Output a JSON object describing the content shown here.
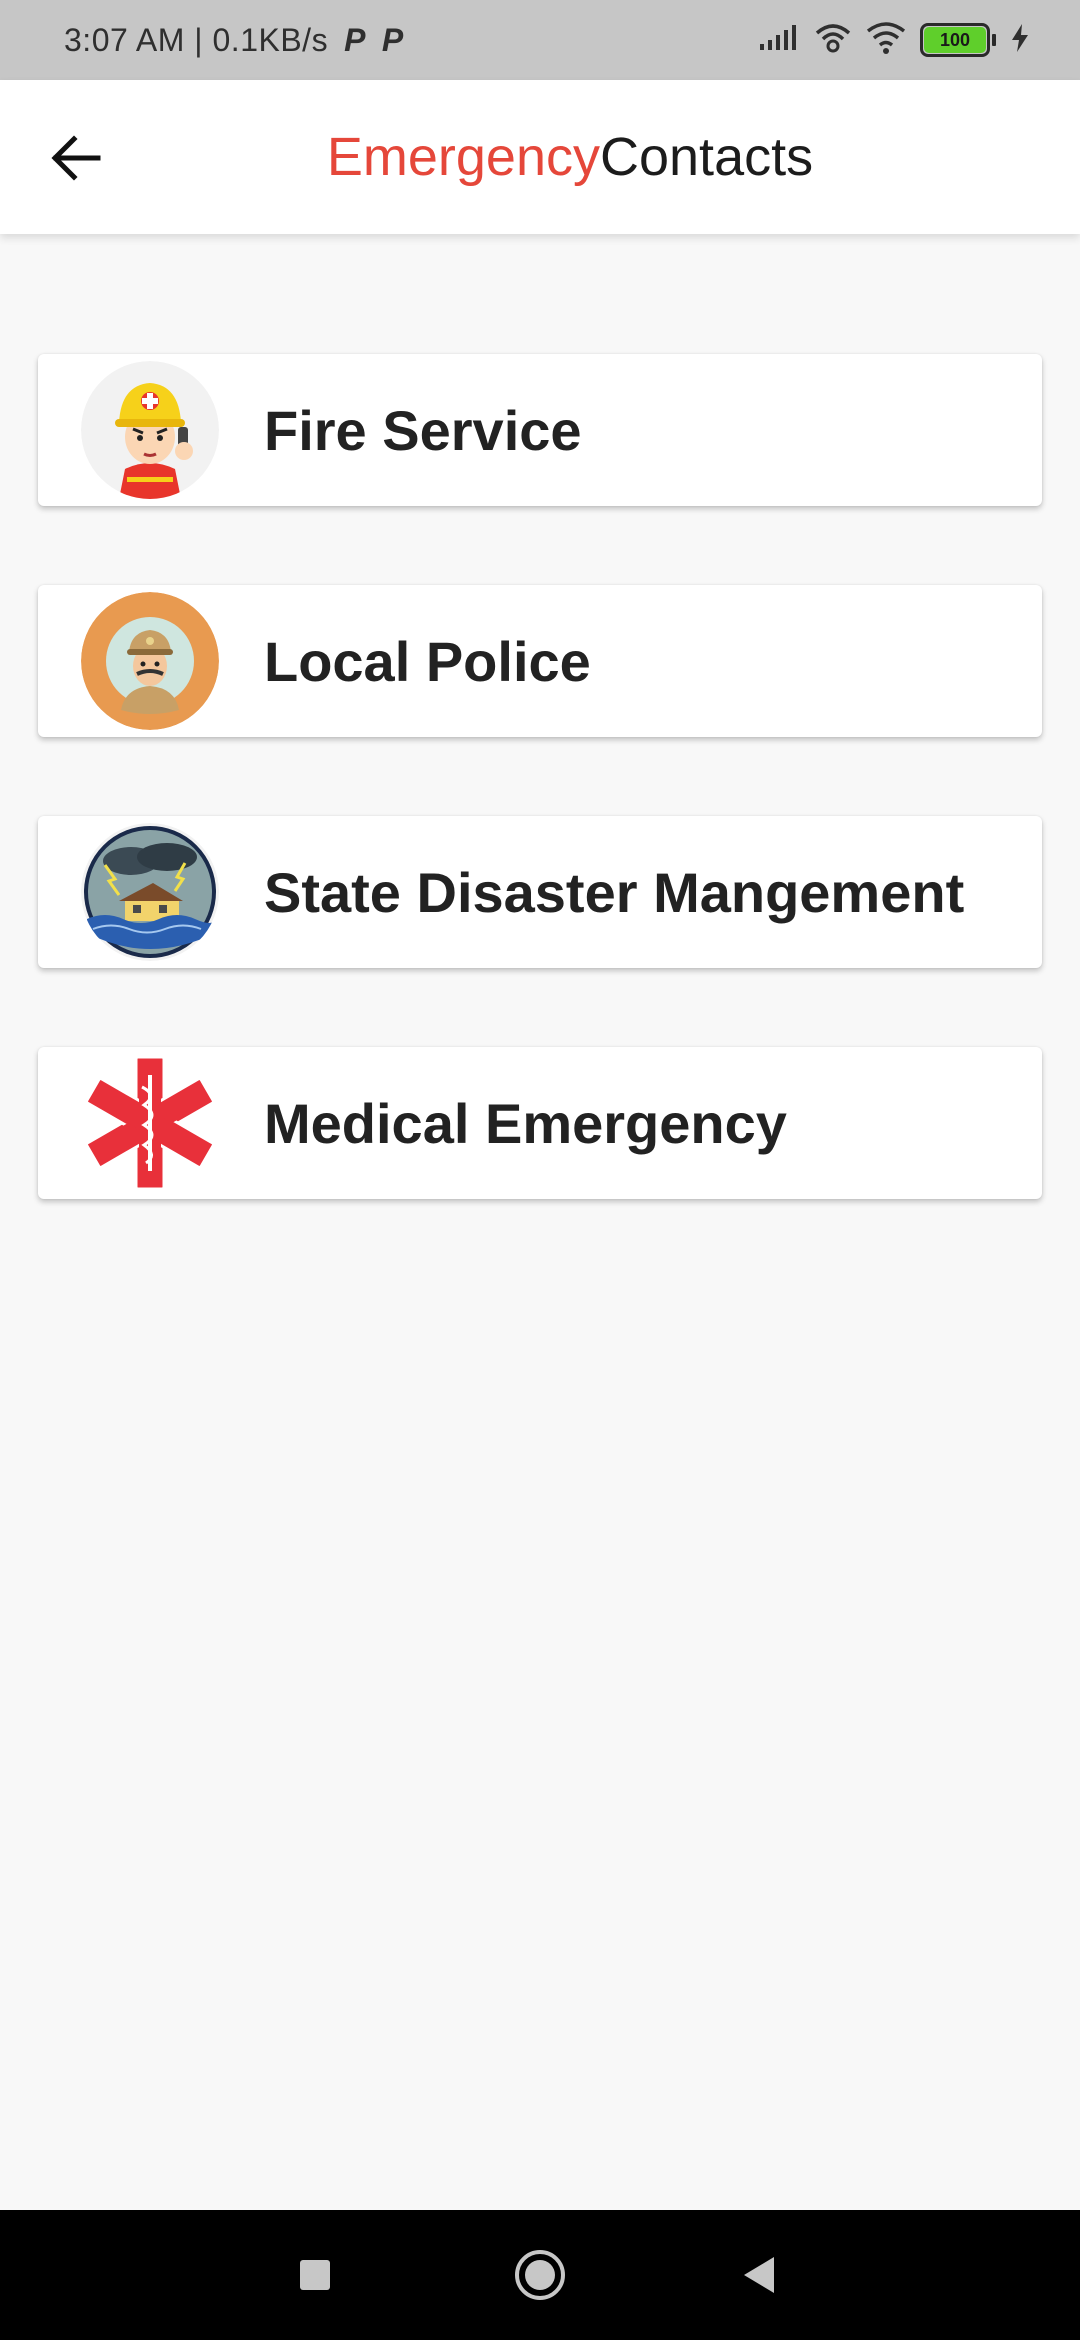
{
  "status_bar": {
    "time_speed": "3:07 AM | 0.1KB/s",
    "p_icon_1": "P",
    "p_icon_2": "P",
    "battery_level": "100"
  },
  "app_bar": {
    "title_part1": "Emergency",
    "title_part2": "Contacts",
    "title_color_1": "#e5473a",
    "title_color_2": "#1c1c1c"
  },
  "contacts": [
    {
      "label": "Fire Service",
      "icon": "firefighter-icon"
    },
    {
      "label": "Local Police",
      "icon": "police-officer-icon"
    },
    {
      "label": "State Disaster Mangement",
      "icon": "flood-disaster-icon"
    },
    {
      "label": "Medical Emergency",
      "icon": "star-of-life-icon"
    }
  ],
  "nav_bar": {
    "recent": "square-recent-apps-icon",
    "home": "circle-home-icon",
    "back": "triangle-back-icon"
  }
}
